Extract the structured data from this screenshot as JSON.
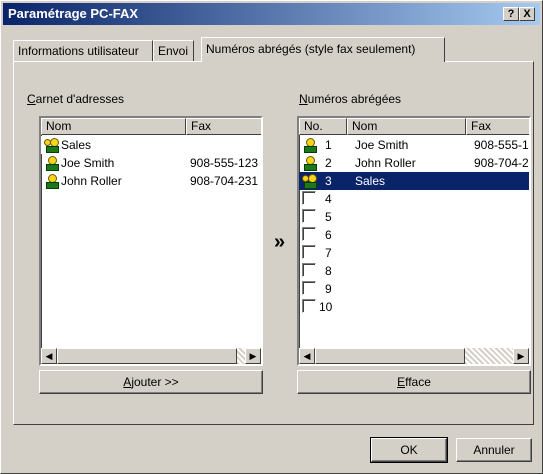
{
  "window": {
    "title": "Paramétrage PC-FAX",
    "help_button": "?",
    "close_button": "X"
  },
  "tabs": [
    {
      "label": "Informations utilisateur"
    },
    {
      "label": "Envoi"
    },
    {
      "label": "Numéros abrégés (style fax seulement)"
    }
  ],
  "address_book": {
    "label_first": "C",
    "label_rest": "arnet d'adresses",
    "columns": {
      "name": "Nom",
      "fax": "Fax"
    },
    "rows": [
      {
        "name": "Sales",
        "fax": "",
        "icon": "group-icon"
      },
      {
        "name": "Joe Smith",
        "fax": "908-555-123",
        "icon": "person-icon"
      },
      {
        "name": "John Roller",
        "fax": "908-704-231",
        "icon": "person-icon"
      }
    ],
    "add_button_first": "A",
    "add_button_rest": "jouter >>"
  },
  "arrow": "»",
  "speed_dial": {
    "label_first": "N",
    "label_rest": "uméros abrégées",
    "columns": {
      "no": "No.",
      "name": "Nom",
      "fax": "Fax"
    },
    "rows": [
      {
        "no": "1",
        "name": "Joe Smith",
        "fax": "908-555-1",
        "icon": "person-icon"
      },
      {
        "no": "2",
        "name": "John Roller",
        "fax": "908-704-2",
        "icon": "person-icon"
      },
      {
        "no": "3",
        "name": "Sales",
        "fax": "",
        "icon": "group-icon",
        "selected": true
      },
      {
        "no": "4",
        "name": "",
        "fax": ""
      },
      {
        "no": "5",
        "name": "",
        "fax": ""
      },
      {
        "no": "6",
        "name": "",
        "fax": ""
      },
      {
        "no": "7",
        "name": "",
        "fax": ""
      },
      {
        "no": "8",
        "name": "",
        "fax": ""
      },
      {
        "no": "9",
        "name": "",
        "fax": ""
      },
      {
        "no": "10",
        "name": "",
        "fax": ""
      }
    ],
    "clear_button_first": "E",
    "clear_button_rest": "fface"
  },
  "footer": {
    "ok": "OK",
    "cancel": "Annuler"
  }
}
